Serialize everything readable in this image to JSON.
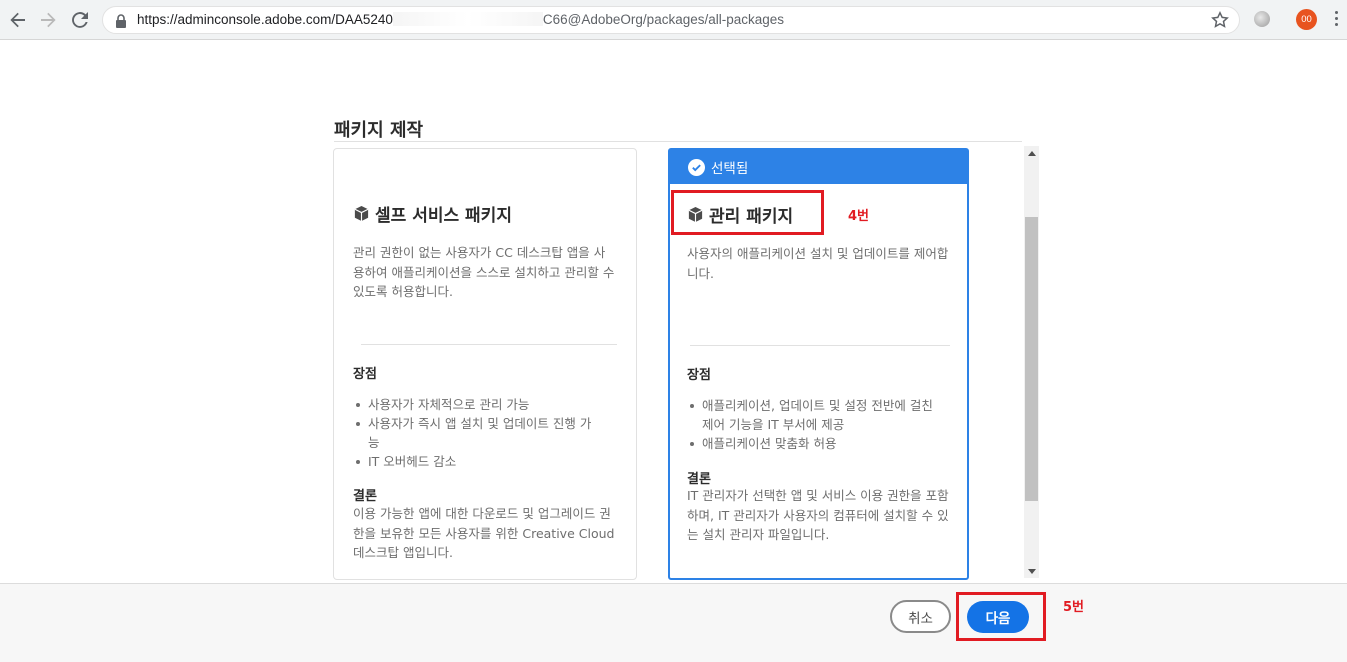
{
  "browser": {
    "url_prefix": "https://adminconsole.adobe.com/DAA5240",
    "url_suffix": "C66@AdobeOrg/packages/all-packages",
    "profile_initials": "00",
    "icons": [
      "back-icon",
      "forward-icon",
      "reload-icon",
      "lock-icon",
      "star-icon",
      "extension-icon",
      "menu-icon"
    ]
  },
  "dialog": {
    "title": "패키지 제작",
    "cards": {
      "self": {
        "title": "셀프 서비스 패키지",
        "desc": "관리 권한이 없는 사용자가 CC 데스크탑 앱을 사용하여 애플리케이션을 스스로 설치하고 관리할 수 있도록 허용합니다.",
        "pros_heading": "장점",
        "pros": [
          "사용자가 자체적으로 관리 가능",
          "사용자가 즉시 앱 설치 및 업데이트 진행 가능",
          "IT 오버헤드 감소"
        ],
        "conclusion_heading": "결론",
        "conclusion": "이용 가능한 앱에 대한 다운로드 및 업그레이드 권한을 보유한 모든 사용자를 위한 Creative Cloud 데스크탑 앱입니다."
      },
      "managed": {
        "selected_label": "선택됨",
        "title": "관리 패키지",
        "desc": "사용자의 애플리케이션 설치 및 업데이트를 제어합니다.",
        "pros_heading": "장점",
        "pros": [
          "애플리케이션, 업데이트 및 설정 전반에 걸친 제어 기능을 IT 부서에 제공",
          "애플리케이션 맞춤화 허용"
        ],
        "conclusion_heading": "결론",
        "conclusion": "IT 관리자가 선택한 앱 및 서비스 이용 권한을 포함하며, IT 관리자가 사용자의 컴퓨터에 설치할 수 있는 설치 관리자 파일입니다."
      }
    }
  },
  "footer": {
    "cancel_label": "취소",
    "next_label": "다음"
  },
  "annotations": {
    "step4": "4번",
    "step5": "5번",
    "color": "#e11b22"
  },
  "colors": {
    "accent": "#2d82e6",
    "primary_button": "#1473e6"
  }
}
